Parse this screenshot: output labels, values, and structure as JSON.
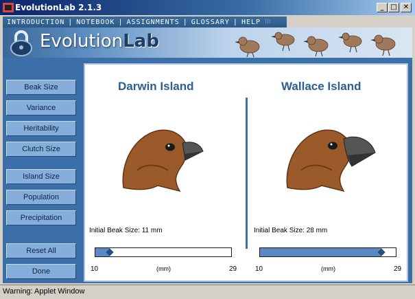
{
  "window": {
    "title": "EvolutionLab 2.1.3",
    "minimize_icon": "minimize-icon",
    "maximize_icon": "maximize-icon",
    "close_icon": "close-icon"
  },
  "menu": {
    "items": [
      "INTRODUCTION",
      "NOTEBOOK",
      "ASSIGNMENTS",
      "GLOSSARY",
      "HELP"
    ],
    "separator": "|"
  },
  "banner": {
    "logo_text_1": "Evolution",
    "logo_text_2": "Lab",
    "logo_icon": "padlock-logo-icon",
    "decoration": "finches-illustration"
  },
  "sidebar": {
    "param_buttons": [
      "Beak Size",
      "Variance",
      "Heritability",
      "Clutch Size"
    ],
    "env_buttons": [
      "Island Size",
      "Population",
      "Precipitation"
    ],
    "action_buttons": [
      "Reset All",
      "Done"
    ]
  },
  "islands": [
    {
      "name": "Darwin Island",
      "info": "Initial Beak Size: 11 mm",
      "slider_value": 11,
      "scale_min": "10",
      "scale_unit": "(mm)",
      "scale_max": "29"
    },
    {
      "name": "Wallace Island",
      "info": "Initial Beak Size: 28 mm",
      "slider_value": 28,
      "scale_min": "10",
      "scale_unit": "(mm)",
      "scale_max": "29"
    }
  ],
  "colors": {
    "panel_blue": "#3c6fa8",
    "button_blue": "#86aedb",
    "title_blue": "#2a5f94"
  },
  "status": "Warning: Applet Window"
}
